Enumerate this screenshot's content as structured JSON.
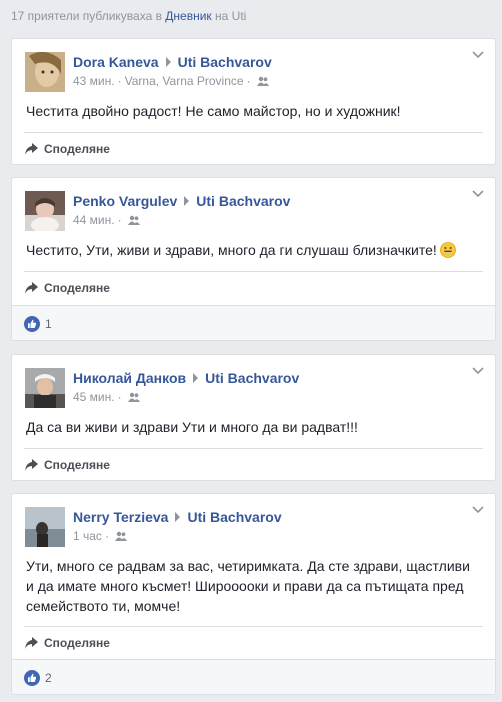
{
  "header": {
    "prefix": "17 приятели публикуваха в",
    "link": "Дневник",
    "suffix": "на Uti"
  },
  "share_label": "Споделяне",
  "posts": [
    {
      "author": "Dora Kaneva",
      "target": "Uti Bachvarov",
      "time": "43 мин.",
      "location": "Varna, Varna Province",
      "text": "Честита двойно радост! Не само майстор, но и художник!"
    },
    {
      "author": "Penko Vargulev",
      "target": "Uti Bachvarov",
      "time": "44 мин.",
      "text": "Честито, Ути, живи и здрави, много да ги слушаш близначките!",
      "likes": "1"
    },
    {
      "author": "Николай Данков",
      "target": "Uti Bachvarov",
      "time": "45 мин.",
      "text": "Да са ви живи и здрави Ути и много да ви радват!!!"
    },
    {
      "author": "Nerry Terzieva",
      "target": "Uti Bachvarov",
      "time": "1 час",
      "text": "Ути, много се радвам за вас, четиримката. Да сте здрави, щастливи и да имате много късмет! Широоооки и прави да са пътищата пред семейството ти, момче!",
      "likes": "2"
    }
  ],
  "icons": {
    "audience": "friends-icon",
    "menu": "chevron-down-icon",
    "share": "share-arrow-icon",
    "like": "like-thumb-icon",
    "emoji": "smile-emoji-icon"
  },
  "colors": {
    "link": "#365899",
    "like_blue": "#4267b2",
    "muted": "#90949c"
  }
}
